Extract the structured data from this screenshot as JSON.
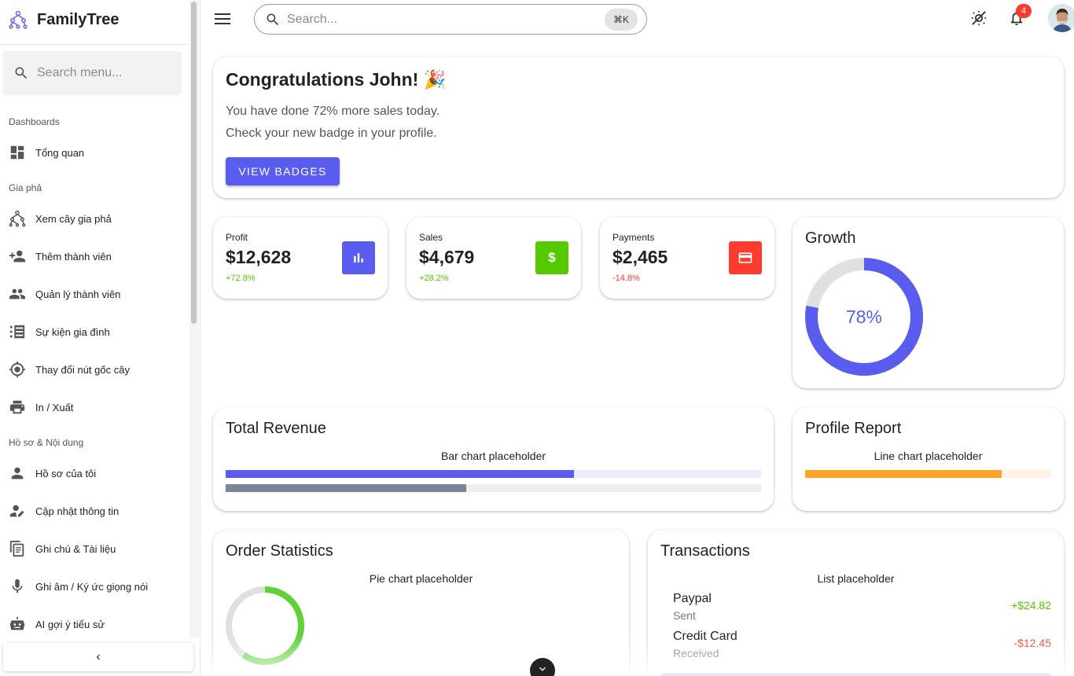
{
  "brand": {
    "name": "FamilyTree"
  },
  "sidebar": {
    "search_placeholder": "Search menu...",
    "sections": [
      {
        "title": "Dashboards"
      },
      {
        "title": "Gia phả"
      },
      {
        "title": "Hồ sơ & Nội dung"
      }
    ],
    "items": [
      {
        "label": "Tổng quan",
        "icon": "dashboard-icon"
      },
      {
        "label": "Xem cây gia phả",
        "icon": "family-tree-icon"
      },
      {
        "label": "Thêm thành viên",
        "icon": "person-add-icon"
      },
      {
        "label": "Quản lý thành viên",
        "icon": "people-icon"
      },
      {
        "label": "Sự kiện gia đình",
        "icon": "event-list-icon"
      },
      {
        "label": "Thay đổi nút gốc cây",
        "icon": "crosshair-icon"
      },
      {
        "label": "In / Xuất",
        "icon": "print-icon"
      },
      {
        "label": "Hồ sơ của tôi",
        "icon": "person-icon"
      },
      {
        "label": "Cập nhật thông tin",
        "icon": "person-edit-icon"
      },
      {
        "label": "Ghi chú & Tài liệu",
        "icon": "document-icon"
      },
      {
        "label": "Ghi âm / Ký ức giọng nói",
        "icon": "microphone-icon"
      },
      {
        "label": "AI gợi ý tiểu sử",
        "icon": "robot-icon"
      }
    ],
    "collapse_label": "‹"
  },
  "topbar": {
    "search_placeholder": "Search...",
    "shortcut": "⌘K",
    "notification_count": "4"
  },
  "welcome": {
    "title": "Congratulations John! 🎉",
    "line1": "You have done 72% more sales today.",
    "line2": "Check your new badge in your profile.",
    "button": "VIEW BADGES"
  },
  "stats": [
    {
      "label": "Profit",
      "value": "$12,628",
      "change": "+72.8%",
      "color": "#5a5cf0",
      "change_color": "#56ca00",
      "icon": "bar-chart-icon"
    },
    {
      "label": "Sales",
      "value": "$4,679",
      "change": "+28.2%",
      "color": "#56ca00",
      "change_color": "#56ca00",
      "icon": "dollar-icon"
    },
    {
      "label": "Payments",
      "value": "$2,465",
      "change": "-14.8%",
      "color": "#ff3b30",
      "change_color": "#ff3b30",
      "icon": "credit-card-icon"
    }
  ],
  "growth": {
    "title": "Growth",
    "percent_label": "78%",
    "value": 0.78,
    "color": "#5a5cf0",
    "track_color": "#e0e0e0"
  },
  "total_revenue": {
    "title": "Total Revenue",
    "placeholder": "Bar chart placeholder",
    "bars": [
      {
        "fraction": 0.65,
        "color": "#5a5cf0",
        "track_color": "#ececfd"
      },
      {
        "fraction": 0.45,
        "color": "#7c8598",
        "track_color": "#eeeeee"
      }
    ]
  },
  "profile_report": {
    "title": "Profile Report",
    "placeholder": "Line chart placeholder",
    "bar": {
      "fraction": 0.8,
      "color": "#ffa22a",
      "track_color": "#fff2e2"
    }
  },
  "order_statistics": {
    "title": "Order Statistics",
    "placeholder": "Pie chart placeholder",
    "donut": {
      "fraction": 0.6,
      "color": "#5fd23a",
      "track_color": "#e0e0e0"
    }
  },
  "transactions": {
    "title": "Transactions",
    "placeholder": "List placeholder",
    "items": [
      {
        "name": "Paypal",
        "sub": "Sent",
        "amount": "+$24.82",
        "color": "#56ca00"
      },
      {
        "name": "Credit Card",
        "sub": "Received",
        "amount": "-$12.45",
        "color": "#ff3b30"
      }
    ]
  }
}
